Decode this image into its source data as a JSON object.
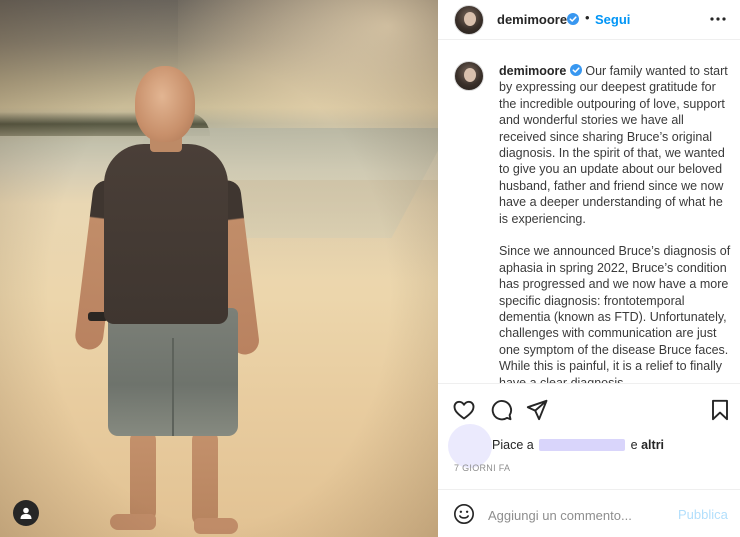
{
  "post": {
    "author": {
      "username": "demimoore",
      "verified": true,
      "follow_label": "Segui",
      "separator": "•"
    },
    "caption": {
      "username": "demimoore",
      "paragraphs": [
        "Our family wanted to start by expressing our deepest gratitude for the incredible outpouring of love, support and wonderful stories we have all received since sharing Bruce’s original diagnosis. In the spirit of that, we wanted to give you an update about our beloved husband, father and friend since we now have a deeper understanding of what he is experiencing.",
        "Since we announced Bruce’s diagnosis of aphasia in spring 2022, Bruce’s condition has progressed and we now have a more specific diagnosis: frontotemporal dementia (known as FTD). Unfortunately, challenges with communication are just one symptom of the disease Bruce faces. While this is painful, it is a relief to finally have a clear diagnosis."
      ]
    },
    "likes": {
      "prefix": "Piace a",
      "suffix": "e",
      "others": "altri"
    },
    "timestamp": "7 GIORNI FA",
    "comment": {
      "placeholder": "Aggiungi un commento...",
      "post_label": "Pubblica"
    }
  },
  "icons": {
    "header_more": "more-options-icon",
    "like": "heart-icon",
    "comment": "comment-icon",
    "share": "share-icon",
    "save": "bookmark-icon",
    "emoji": "emoji-icon",
    "verified": "verified-badge-icon",
    "user_tag": "user-tag-icon"
  },
  "colors": {
    "accent": "#0095f6",
    "verified": "#3897f0",
    "post_disabled": "#b2dffc",
    "muted": "#8e8e8e"
  }
}
